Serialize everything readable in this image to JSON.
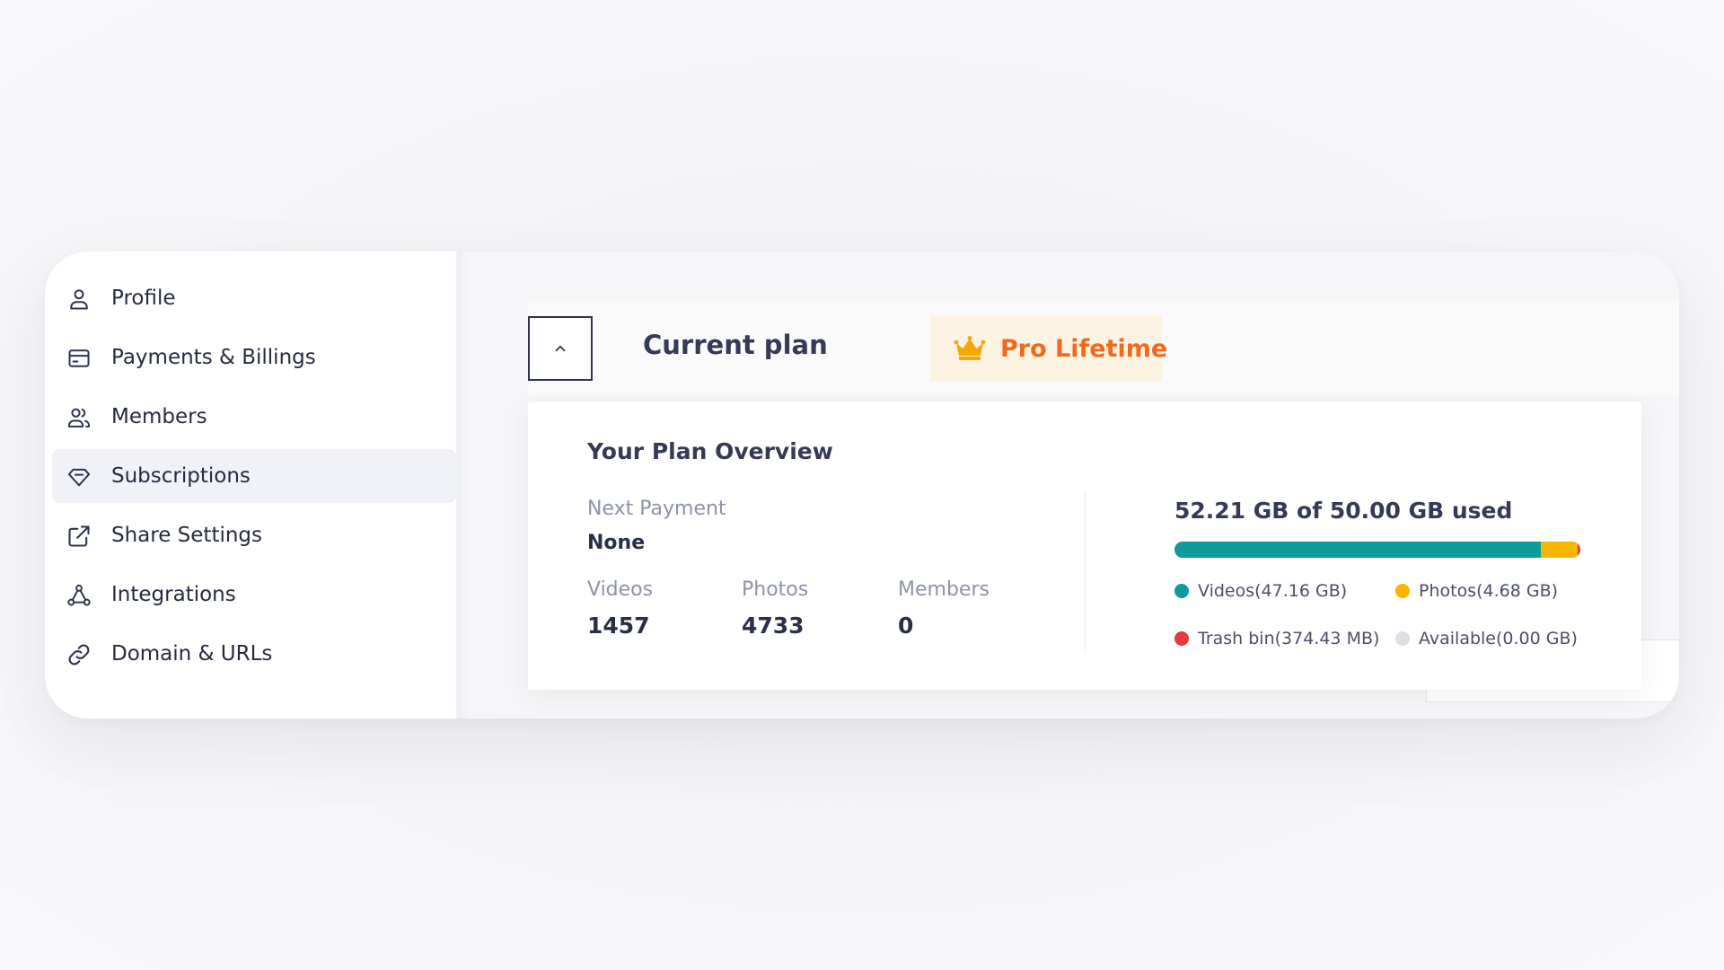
{
  "sidebar": {
    "items": [
      {
        "label": "Profile",
        "icon": "user-icon"
      },
      {
        "label": "Payments & Billings",
        "icon": "credit-card-icon"
      },
      {
        "label": "Members",
        "icon": "users-icon"
      },
      {
        "label": "Subscriptions",
        "icon": "diamond-icon",
        "active": true
      },
      {
        "label": "Share Settings",
        "icon": "external-link-icon"
      },
      {
        "label": "Integrations",
        "icon": "network-icon"
      },
      {
        "label": "Domain & URLs",
        "icon": "link-icon"
      }
    ]
  },
  "plan": {
    "collapse_icon": "chevron-up-icon",
    "title": "Current plan",
    "badge_icon": "crown-icon",
    "badge": "Pro Lifetime"
  },
  "overview": {
    "title": "Your Plan Overview",
    "next_payment_label": "Next Payment",
    "next_payment_value": "None",
    "stats": [
      {
        "label": "Videos",
        "value": "1457"
      },
      {
        "label": "Photos",
        "value": "4733"
      },
      {
        "label": "Members",
        "value": "0"
      }
    ]
  },
  "storage": {
    "summary": "52.21 GB of 50.00 GB used",
    "segments": [
      {
        "key": "videos",
        "fraction": 0.9029,
        "color": "#0f9b9b"
      },
      {
        "key": "photos",
        "fraction": 0.0896,
        "color": "#f7b500"
      },
      {
        "key": "trash",
        "fraction": 0.0075,
        "color": "#e83a3a"
      },
      {
        "key": "available",
        "fraction": 0.0,
        "color": "#dcdee3"
      }
    ],
    "legend": [
      {
        "label": "Videos(47.16 GB)",
        "color": "#0f9b9b"
      },
      {
        "label": "Photos(4.68 GB)",
        "color": "#f7b500"
      },
      {
        "label": "Trash bin(374.43 MB)",
        "color": "#e83a3a"
      },
      {
        "label": "Available(0.00 GB)",
        "color": "#dcdee3"
      }
    ]
  },
  "colors": {
    "accent_orange": "#f0691c",
    "badge_bg": "#fdf3e3",
    "active_item_bg": "#f0f2f7"
  }
}
